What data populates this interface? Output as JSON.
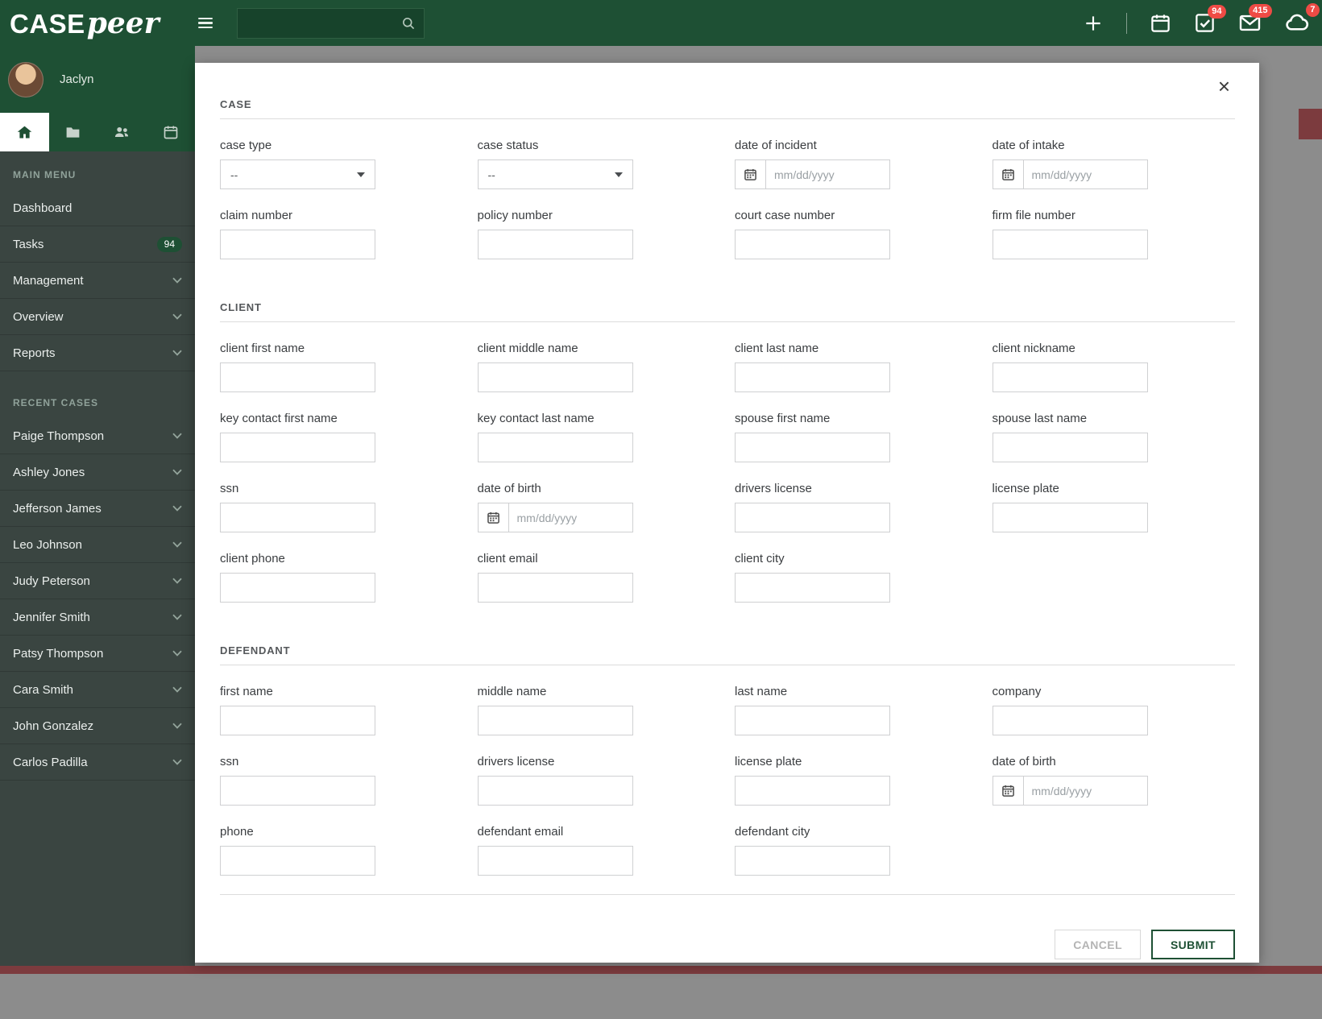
{
  "header": {
    "logo_case": "CASE",
    "logo_peer": "peer",
    "search": {
      "value": "",
      "placeholder": ""
    },
    "badges": {
      "tasks": "94",
      "messages": "415",
      "cloud": "7"
    },
    "icons": [
      "hamburger-icon",
      "search-icon",
      "plus-icon",
      "calendar-icon",
      "check-square-icon",
      "envelope-icon",
      "cloud-icon"
    ]
  },
  "sidebar": {
    "user_name": "Jaclyn",
    "tabs": [
      {
        "icon": "home-icon",
        "active": true
      },
      {
        "icon": "folder-icon",
        "active": false
      },
      {
        "icon": "people-icon",
        "active": false
      },
      {
        "icon": "calendar-icon",
        "active": false
      }
    ],
    "main_menu_label": "MAIN MENU",
    "recent_cases_label": "RECENT CASES",
    "menu_items": [
      {
        "label": "Dashboard"
      },
      {
        "label": "Tasks",
        "badge": "94"
      },
      {
        "label": "Management",
        "chevron": true
      },
      {
        "label": "Overview",
        "chevron": true
      },
      {
        "label": "Reports",
        "chevron": true
      }
    ],
    "recent_cases": [
      {
        "label": "Paige Thompson"
      },
      {
        "label": "Ashley Jones"
      },
      {
        "label": "Jefferson James"
      },
      {
        "label": "Leo Johnson"
      },
      {
        "label": "Judy Peterson"
      },
      {
        "label": "Jennifer Smith"
      },
      {
        "label": "Patsy Thompson"
      },
      {
        "label": "Cara Smith"
      },
      {
        "label": "John Gonzalez"
      },
      {
        "label": "Carlos Padilla"
      }
    ]
  },
  "modal": {
    "close_glyph": "×",
    "select_value": "--",
    "date_placeholder": "mm/dd/yyyy",
    "sections": [
      {
        "title": "CASE",
        "rows": [
          [
            {
              "label": "case type",
              "type": "select"
            },
            {
              "label": "case status",
              "type": "select"
            },
            {
              "label": "date of incident",
              "type": "date"
            },
            {
              "label": "date of intake",
              "type": "date"
            }
          ],
          [
            {
              "label": "claim number",
              "type": "text"
            },
            {
              "label": "policy number",
              "type": "text"
            },
            {
              "label": "court case number",
              "type": "text"
            },
            {
              "label": "firm file number",
              "type": "text"
            }
          ]
        ]
      },
      {
        "title": "CLIENT",
        "rows": [
          [
            {
              "label": "client first name",
              "type": "text"
            },
            {
              "label": "client middle name",
              "type": "text"
            },
            {
              "label": "client last name",
              "type": "text"
            },
            {
              "label": "client nickname",
              "type": "text"
            }
          ],
          [
            {
              "label": "key contact first name",
              "type": "text"
            },
            {
              "label": "key contact last name",
              "type": "text"
            },
            {
              "label": "spouse first name",
              "type": "text"
            },
            {
              "label": "spouse last name",
              "type": "text"
            }
          ],
          [
            {
              "label": "ssn",
              "type": "text"
            },
            {
              "label": "date of birth",
              "type": "date"
            },
            {
              "label": "drivers license",
              "type": "text"
            },
            {
              "label": "license plate",
              "type": "text"
            }
          ],
          [
            {
              "label": "client phone",
              "type": "text"
            },
            {
              "label": "client email",
              "type": "text"
            },
            {
              "label": "client city",
              "type": "text"
            }
          ]
        ]
      },
      {
        "title": "DEFENDANT",
        "rows": [
          [
            {
              "label": "first name",
              "type": "text"
            },
            {
              "label": "middle name",
              "type": "text"
            },
            {
              "label": "last name",
              "type": "text"
            },
            {
              "label": "company",
              "type": "text"
            }
          ],
          [
            {
              "label": "ssn",
              "type": "text"
            },
            {
              "label": "drivers license",
              "type": "text"
            },
            {
              "label": "license plate",
              "type": "text"
            },
            {
              "label": "date of birth",
              "type": "date"
            }
          ],
          [
            {
              "label": "phone",
              "type": "text"
            },
            {
              "label": "defendant email",
              "type": "text"
            },
            {
              "label": "defendant city",
              "type": "text"
            }
          ]
        ]
      }
    ],
    "cancel_label": "CANCEL",
    "submit_label": "SUBMIT"
  },
  "colors": {
    "header_green": "#1e5034",
    "sidebar_bg": "#3a4541",
    "badge_red": "#ee4b45",
    "backdrop_gray": "#8c8c8c",
    "footer_maroon": "#7c3b3e",
    "accent_green": "#1e5034"
  }
}
